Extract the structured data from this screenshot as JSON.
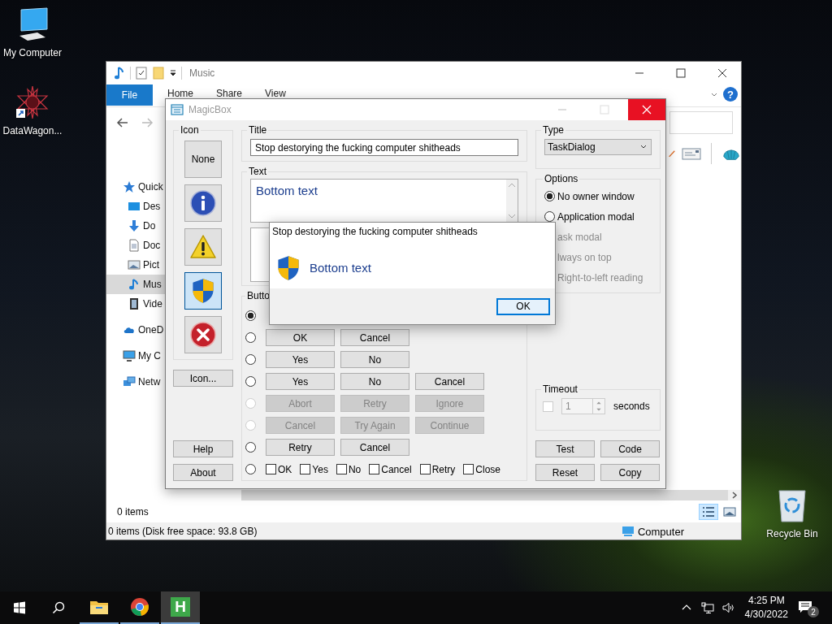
{
  "desktop_icons": [
    {
      "kind": "computer",
      "label": "My Computer"
    },
    {
      "kind": "shortcut",
      "label": "DataWagon..."
    },
    {
      "kind": "recycle",
      "label": "Recycle Bin"
    }
  ],
  "explorer": {
    "title": "Music",
    "file_menu": "File",
    "ribbon_tabs": [
      "Home",
      "Share",
      "View"
    ],
    "help_glyph": "?",
    "nav_items": [
      {
        "kind": "star",
        "label": "Quick",
        "selected": false,
        "children": [
          {
            "kind": "desktop",
            "label": "Des",
            "selected": false
          },
          {
            "kind": "download",
            "label": "Do",
            "selected": false
          },
          {
            "kind": "document",
            "label": "Doc",
            "selected": false
          },
          {
            "kind": "picture",
            "label": "Pict",
            "selected": false
          },
          {
            "kind": "music",
            "label": "Mus",
            "selected": true
          },
          {
            "kind": "video",
            "label": "Vide",
            "selected": false
          }
        ]
      },
      {
        "kind": "cloud",
        "label": "OneD",
        "selected": false
      },
      {
        "kind": "computer",
        "label": "My C",
        "selected": false
      },
      {
        "kind": "network",
        "label": "Netw",
        "selected": false
      }
    ],
    "view_modes": [
      {
        "kind": "details",
        "selected": true
      },
      {
        "kind": "tiles",
        "selected": false
      }
    ],
    "items_count": "0 items",
    "status_text": "0 items (Disk free space: 93.8 GB)",
    "status_location": "Computer"
  },
  "magicbox": {
    "title": "MagicBox",
    "icon_group": {
      "label": "Icon",
      "icons": [
        {
          "kind": "none",
          "label": "None",
          "selected": false
        },
        {
          "kind": "info",
          "selected": false
        },
        {
          "kind": "warning",
          "selected": false
        },
        {
          "kind": "shield",
          "selected": true
        },
        {
          "kind": "error",
          "selected": false
        }
      ],
      "browse_button": "Icon..."
    },
    "side_buttons": [
      "Help",
      "About"
    ],
    "title_group": {
      "label": "Title",
      "value": "Stop destorying the fucking computer shitheads"
    },
    "text_group": {
      "label": "Text",
      "value": "Bottom text"
    },
    "buttons_group": {
      "label": "Butto",
      "rows": [
        {
          "kind": "buttons",
          "selected": true,
          "disabled": false
        },
        {
          "kind": "buttons",
          "selected": false,
          "disabled": false,
          "buttons": [
            "OK",
            "Cancel"
          ]
        },
        {
          "kind": "buttons",
          "selected": false,
          "disabled": false,
          "buttons": [
            "Yes",
            "No"
          ]
        },
        {
          "kind": "buttons",
          "selected": false,
          "disabled": false,
          "buttons": [
            "Yes",
            "No",
            "Cancel"
          ]
        },
        {
          "kind": "buttons",
          "selected": false,
          "disabled": true,
          "buttons": [
            "Abort",
            "Retry",
            "Ignore"
          ]
        },
        {
          "kind": "buttons",
          "selected": false,
          "disabled": true,
          "buttons": [
            "Cancel",
            "Try Again",
            "Continue"
          ]
        },
        {
          "kind": "buttons",
          "selected": false,
          "disabled": false,
          "buttons": [
            "Retry",
            "Cancel"
          ]
        },
        {
          "kind": "checkboxes",
          "selected": false,
          "disabled": false,
          "checkboxes": [
            {
              "label": "OK",
              "checked": false
            },
            {
              "label": "Yes",
              "checked": false
            },
            {
              "label": "No",
              "checked": false
            },
            {
              "label": "Cancel",
              "checked": false
            },
            {
              "label": "Retry",
              "checked": false
            },
            {
              "label": "Close",
              "checked": false
            }
          ]
        }
      ]
    },
    "type_group": {
      "label": "Type",
      "value": "TaskDialog"
    },
    "options_group": {
      "label": "Options",
      "items": [
        {
          "kind": "radio",
          "label": "No owner window",
          "selected": true,
          "disabled": false
        },
        {
          "kind": "radio",
          "label": "Application modal",
          "selected": false,
          "disabled": false
        },
        {
          "kind": "covered",
          "label": "ask modal",
          "disabled": true
        },
        {
          "kind": "covered",
          "label": "lways on top",
          "disabled": true
        },
        {
          "kind": "covered",
          "label": "Right-to-left reading",
          "disabled": true
        }
      ]
    },
    "timeout_group": {
      "label": "Timeout",
      "checked": false,
      "value": "1",
      "unit": "seconds"
    },
    "action_buttons": [
      "Test",
      "Code",
      "Reset",
      "Copy"
    ]
  },
  "dialog": {
    "title": "Stop destorying the fucking computer shitheads",
    "message": "Bottom text",
    "button": "OK"
  },
  "taskbar": {
    "apps": [
      {
        "kind": "folder",
        "selected": false
      },
      {
        "kind": "browser",
        "selected": false
      },
      {
        "kind": "letter",
        "label": "H",
        "selected": true
      }
    ],
    "time": "4:25 PM",
    "date": "4/30/2022",
    "notifications": "2"
  }
}
